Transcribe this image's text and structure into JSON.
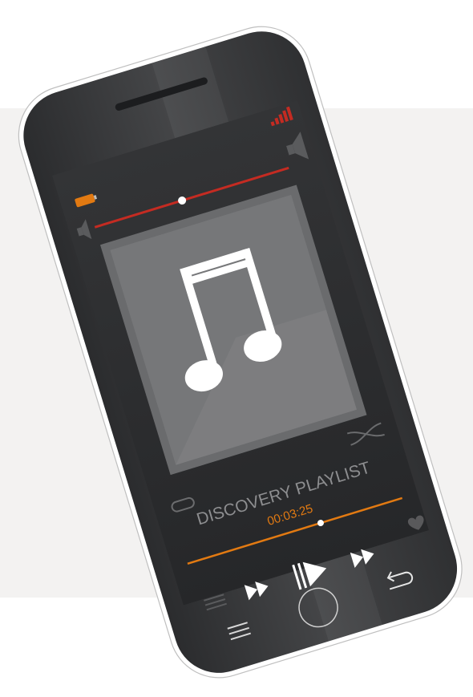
{
  "playlist": {
    "title": "DISCOVERY PLAYLIST",
    "elapsed": "00:03:25",
    "progress": 0.62
  },
  "volume": {
    "level": 0.45
  },
  "battery": {
    "level": 0.85
  },
  "signal": {
    "bars": 5
  },
  "colors": {
    "accent_orange": "#e27a12",
    "accent_red": "#c42b22",
    "body": "#3a3b3d",
    "screen": "#2c2d2f",
    "artwork": "#6e6f71"
  },
  "icons": [
    "signal-icon",
    "battery-icon",
    "speaker-low-icon",
    "speaker-high-icon",
    "music-note-icon",
    "shuffle-icon",
    "repeat-icon",
    "heart-icon",
    "menu-icon",
    "fast-forward-icon",
    "play-pause-icon",
    "back-arrow-icon"
  ]
}
